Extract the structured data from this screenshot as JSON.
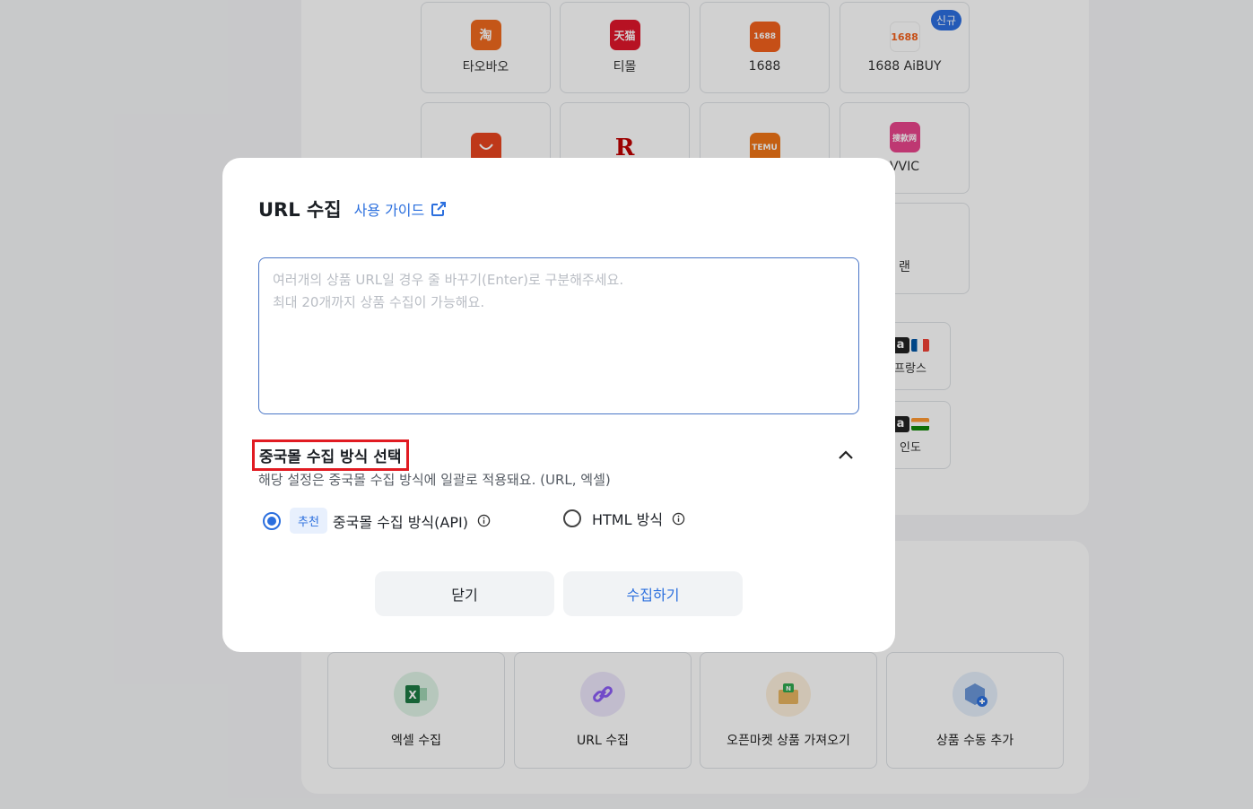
{
  "background": {
    "platforms": [
      {
        "label": "타오바오",
        "logo_text": "淘",
        "color": "#f06a1e"
      },
      {
        "label": "티몰",
        "logo_text": "天猫",
        "color": "#e0162b"
      },
      {
        "label": "1688",
        "logo_text": "1688",
        "color": "#f2611d"
      },
      {
        "label": "1688 AiBUY",
        "logo_text": "1688",
        "color": "#ffffff",
        "badge": "신규"
      },
      {
        "label": "",
        "logo_text": "",
        "color": "#e8451f"
      },
      {
        "label": "",
        "logo_text": "R",
        "color": "#ffffff"
      },
      {
        "label": "",
        "logo_text": "TEMU",
        "color": "#f07516"
      },
      {
        "label": "VVIC",
        "logo_text": "搜款网",
        "color": "#e8458c"
      },
      {
        "label": "랜",
        "logo_text": "",
        "color": "#ffffff"
      }
    ],
    "amazon": [
      {
        "label": "프랑스",
        "a": "a"
      },
      {
        "label": "인도",
        "a": "a"
      }
    ],
    "methods": [
      {
        "label": "엑셀 수집"
      },
      {
        "label": "URL 수집"
      },
      {
        "label": "오픈마켓 상품 가져오기"
      },
      {
        "label": "상품 수동 추가"
      }
    ]
  },
  "modal": {
    "title": "URL 수집",
    "guide_link": "사용 가이드",
    "url_placeholder": "여러개의 상품 URL일 경우 줄 바꾸기(Enter)로 구분해주세요.\n최대 20개까지 상품 수집이 가능해요.",
    "section_title": "중국몰 수집 방식 선택",
    "section_desc": "해당 설정은 중국몰 수집 방식에 일괄로 적용돼요. (URL, 엑셀)",
    "options": [
      {
        "badge": "추천",
        "label": "중국몰 수집 방식(API)",
        "selected": true
      },
      {
        "label": "HTML 방식",
        "selected": false
      }
    ],
    "close_button": "닫기",
    "collect_button": "수집하기"
  },
  "colors": {
    "accent": "#2b6fde",
    "highlight": "#e11b22"
  }
}
